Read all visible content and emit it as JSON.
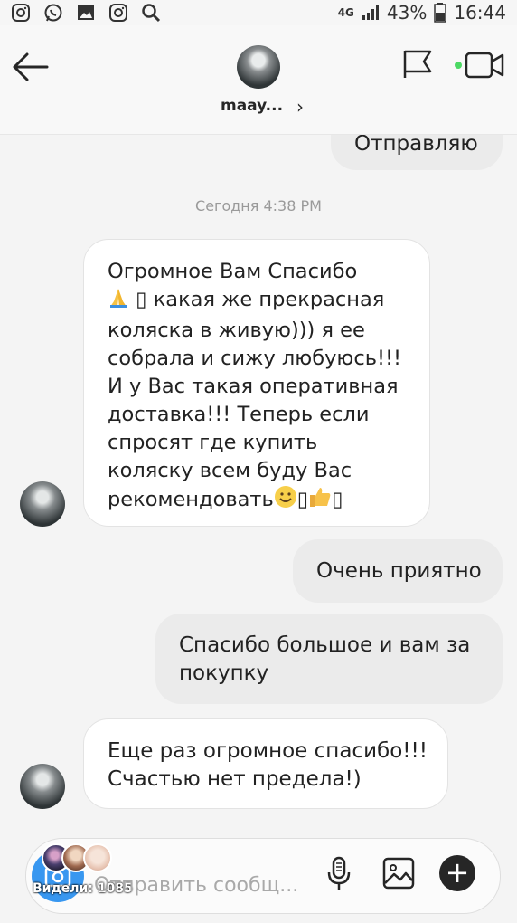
{
  "status_bar": {
    "network": "4G",
    "battery": "43%",
    "time": "16:44"
  },
  "header": {
    "username": "maay...",
    "chevron": "›"
  },
  "timestamp": "Сегодня 4:38 PM",
  "messages": [
    {
      "direction": "out",
      "text": "Отправляю"
    },
    {
      "direction": "in",
      "lines": [
        "Огромное Вам Спасибо",
        "какая же прекрасная",
        "коляска в живую))) я ее",
        "собрала и сижу любуюсь!!!",
        "И у Вас такая оперативная",
        "доставка!!! Теперь если",
        "спросят где купить",
        "коляску всем буду Вас",
        "рекомендовать"
      ]
    },
    {
      "direction": "out",
      "text": "Очень приятно"
    },
    {
      "direction": "out",
      "lines": [
        "Спасибо большое и вам за",
        "покупку"
      ]
    },
    {
      "direction": "in",
      "lines": [
        "Еще раз огромное спасибо!!!",
        "Счастью нет предела!)"
      ]
    }
  ],
  "composer": {
    "placeholder": "Отправить сообщ...",
    "viewers_label": "Видели: 1085"
  },
  "colors": {
    "accent": "#3897f0",
    "outgoing_bubble": "#ebebeb",
    "incoming_bubble": "#ffffff"
  },
  "icons": [
    "instagram-icon",
    "whatsapp-icon",
    "image-icon",
    "instagram-icon",
    "search-icon",
    "back-arrow-icon",
    "flag-icon",
    "video-call-icon",
    "camera-icon",
    "microphone-icon",
    "gallery-icon",
    "plus-icon",
    "folded-hands-emoji",
    "smile-emoji",
    "thumbs-up-emoji"
  ]
}
